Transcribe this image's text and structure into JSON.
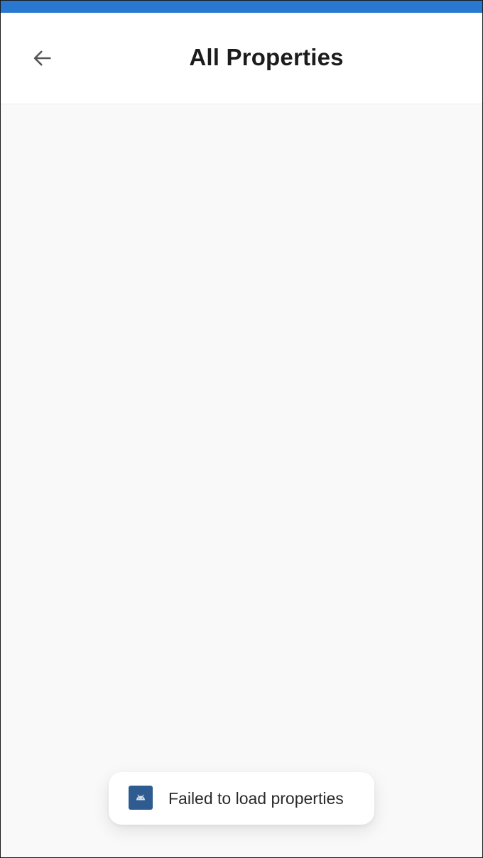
{
  "status_bar": {
    "color": "#2878d0"
  },
  "header": {
    "back_icon": "arrow-left-icon",
    "title": "All Properties"
  },
  "toast": {
    "icon": "android-app-icon",
    "message": "Failed to load properties"
  },
  "colors": {
    "background": "#f9f9f9",
    "app_bar": "#ffffff",
    "title_text": "#1c1c1c",
    "toast_icon_bg": "#2f5c90"
  }
}
